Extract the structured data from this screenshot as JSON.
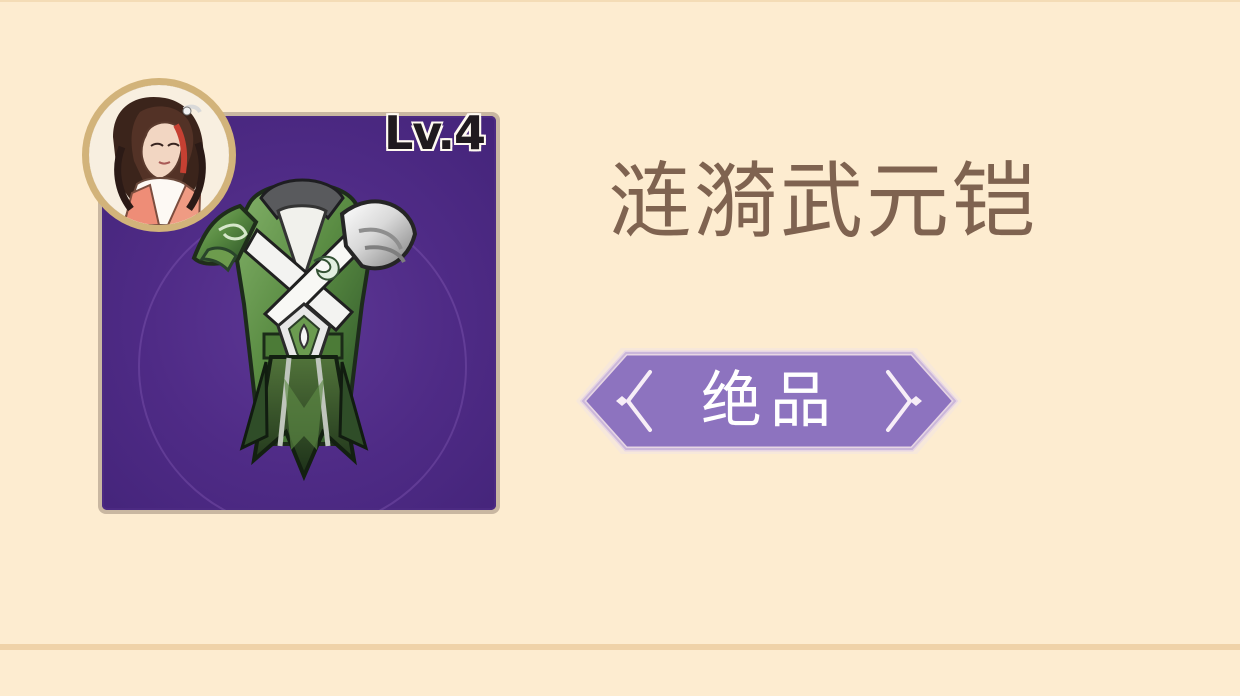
{
  "item": {
    "level": "Lv.4",
    "name": "涟漪武元铠",
    "rarity": "绝品"
  },
  "icons": {
    "avatar": "character-portrait-icon",
    "item": "armor-icon",
    "rarity_left": "chevron-left-icon",
    "rarity_right": "chevron-right-icon"
  },
  "colors": {
    "background": "#fdecd0",
    "item_background": "#4f2b86",
    "rarity_purple": "#8d73bf",
    "name_text": "#7f6350"
  }
}
